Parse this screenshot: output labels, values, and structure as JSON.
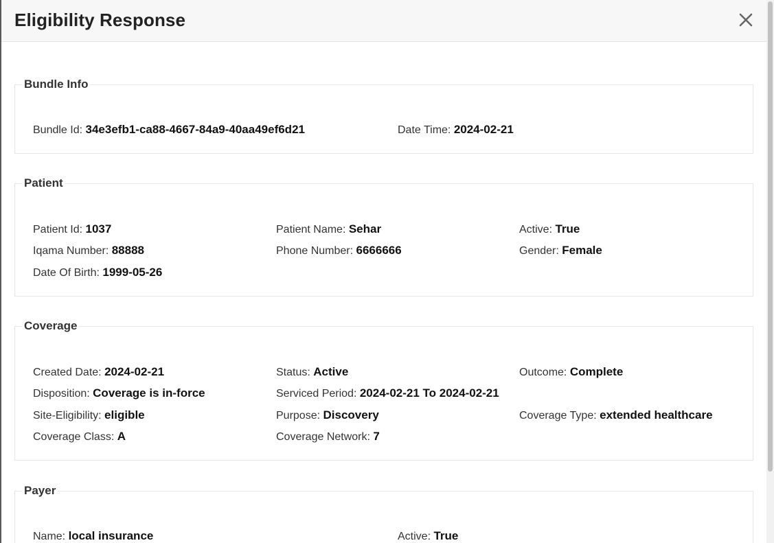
{
  "modal": {
    "title": "Eligibility Response",
    "close_icon": "close-icon"
  },
  "bundle": {
    "title": "Bundle Info",
    "bundle_id_label": "Bundle Id:",
    "bundle_id": "34e3efb1-ca88-4667-84a9-40aa49ef6d21",
    "date_time_label": "Date Time:",
    "date_time": "2024-02-21"
  },
  "patient": {
    "title": "Patient",
    "id_label": "Patient Id:",
    "id": "1037",
    "name_label": "Patient Name:",
    "name": "Sehar",
    "active_label": "Active:",
    "active": "True",
    "iqama_label": "Iqama Number:",
    "iqama": "88888",
    "phone_label": "Phone Number:",
    "phone": "6666666",
    "gender_label": "Gender:",
    "gender": "Female",
    "dob_label": "Date Of Birth:",
    "dob": "1999-05-26"
  },
  "coverage": {
    "title": "Coverage",
    "created_label": "Created Date:",
    "created": "2024-02-21",
    "status_label": "Status:",
    "status": "Active",
    "outcome_label": "Outcome:",
    "outcome": "Complete",
    "disposition_label": "Disposition:",
    "disposition": "Coverage is in-force",
    "serviced_label": "Serviced Period:",
    "serviced": "2024-02-21 To 2024-02-21",
    "site_label": "Site-Eligibility:",
    "site": "eligible",
    "purpose_label": "Purpose:",
    "purpose": "Discovery",
    "type_label": "Coverage Type:",
    "type": "extended healthcare",
    "class_label": "Coverage Class:",
    "class": "A",
    "network_label": "Coverage Network:",
    "network": "7"
  },
  "payer": {
    "title": "Payer",
    "name_label": "Name:",
    "name": "local insurance",
    "active_label": "Active:",
    "active": "True"
  }
}
